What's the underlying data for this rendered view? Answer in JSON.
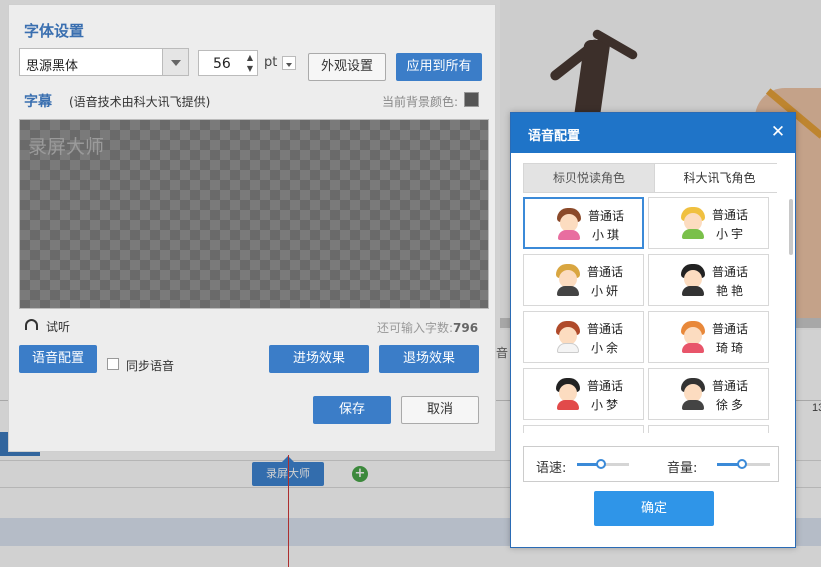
{
  "background": {
    "clip_label": "录屏大师",
    "add_symbol": "+",
    "ruler_number": "13",
    "partial_text": "音"
  },
  "font_panel": {
    "title": "字体设置",
    "font_family": "思源黑体",
    "font_size": "56",
    "size_unit": "pt",
    "appearance_button": "外观设置",
    "apply_all_button": "应用到所有",
    "subtitle_heading": "字幕",
    "subtitle_note": "(语音技术由科大讯飞提供)",
    "bg_color_label": "当前背景颜色:",
    "bg_color": "#555555",
    "preview_text": "录屏大师",
    "listen_label": "试听",
    "remaining_label": "还可输入字数:",
    "remaining_count": "796",
    "voice_config_button": "语音配置",
    "sync_voice_label": "同步语音",
    "sync_voice_checked": false,
    "enter_effect_button": "进场效果",
    "exit_effect_button": "退场效果",
    "save_button": "保存",
    "cancel_button": "取消"
  },
  "voice_dialog": {
    "title": "语音配置",
    "close_symbol": "✕",
    "tabs": [
      {
        "label": "标贝悦读角色",
        "active": false
      },
      {
        "label": "科大讯飞角色",
        "active": true
      }
    ],
    "voices": [
      {
        "lang": "普通话",
        "name": "小琪",
        "avatar": "girl-avatar-icon",
        "selected": true
      },
      {
        "lang": "普通话",
        "name": "小宇",
        "avatar": "boy-avatar-icon",
        "selected": false
      },
      {
        "lang": "普通话",
        "name": "小妍",
        "avatar": "man-glasses-avatar-icon",
        "selected": false
      },
      {
        "lang": "普通话",
        "name": "艳艳",
        "avatar": "woman-headset-avatar-icon",
        "selected": false
      },
      {
        "lang": "普通话",
        "name": "小余",
        "avatar": "boy-red-hair-avatar-icon",
        "selected": false
      },
      {
        "lang": "普通话",
        "name": "琦琦",
        "avatar": "girl-orange-hair-avatar-icon",
        "selected": false
      },
      {
        "lang": "普通话",
        "name": "小梦",
        "avatar": "girl-smile-avatar-icon",
        "selected": false
      },
      {
        "lang": "普通话",
        "name": "徐多",
        "avatar": "man-mustache-avatar-icon",
        "selected": false
      }
    ],
    "speed_label": "语速:",
    "speed_value": 0.5,
    "volume_label": "音量:",
    "volume_value": 0.5,
    "ok_button": "确定"
  },
  "colors": {
    "accent": "#1f74c8",
    "button_blue": "#3b7dc8",
    "ok_blue": "#2f95e8"
  }
}
